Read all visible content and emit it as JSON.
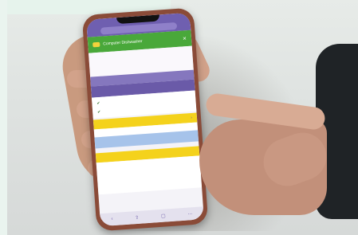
{
  "phone": {
    "url": "",
    "app_title": "Computer Dishwasher",
    "notice_line1": "",
    "notice_line2": "",
    "section_title": "",
    "section_action": "",
    "cells": [
      {
        "label": "",
        "value": "✔"
      },
      {
        "label": "",
        "value": ""
      },
      {
        "label": "",
        "value": "✔"
      },
      {
        "label": "",
        "value": ""
      }
    ],
    "blue_left": "",
    "blue_right": "",
    "yellow2_label": "",
    "close_icon": "close-icon",
    "nav_icons": [
      "back-icon",
      "share-icon",
      "tabs-icon",
      "menu-icon"
    ]
  },
  "colors": {
    "header_green": "#49a83a",
    "purple": "#6a5aa8",
    "yellow": "#f4d21c",
    "light_blue": "#a6c3ea",
    "phone_case": "#8a4b38"
  }
}
